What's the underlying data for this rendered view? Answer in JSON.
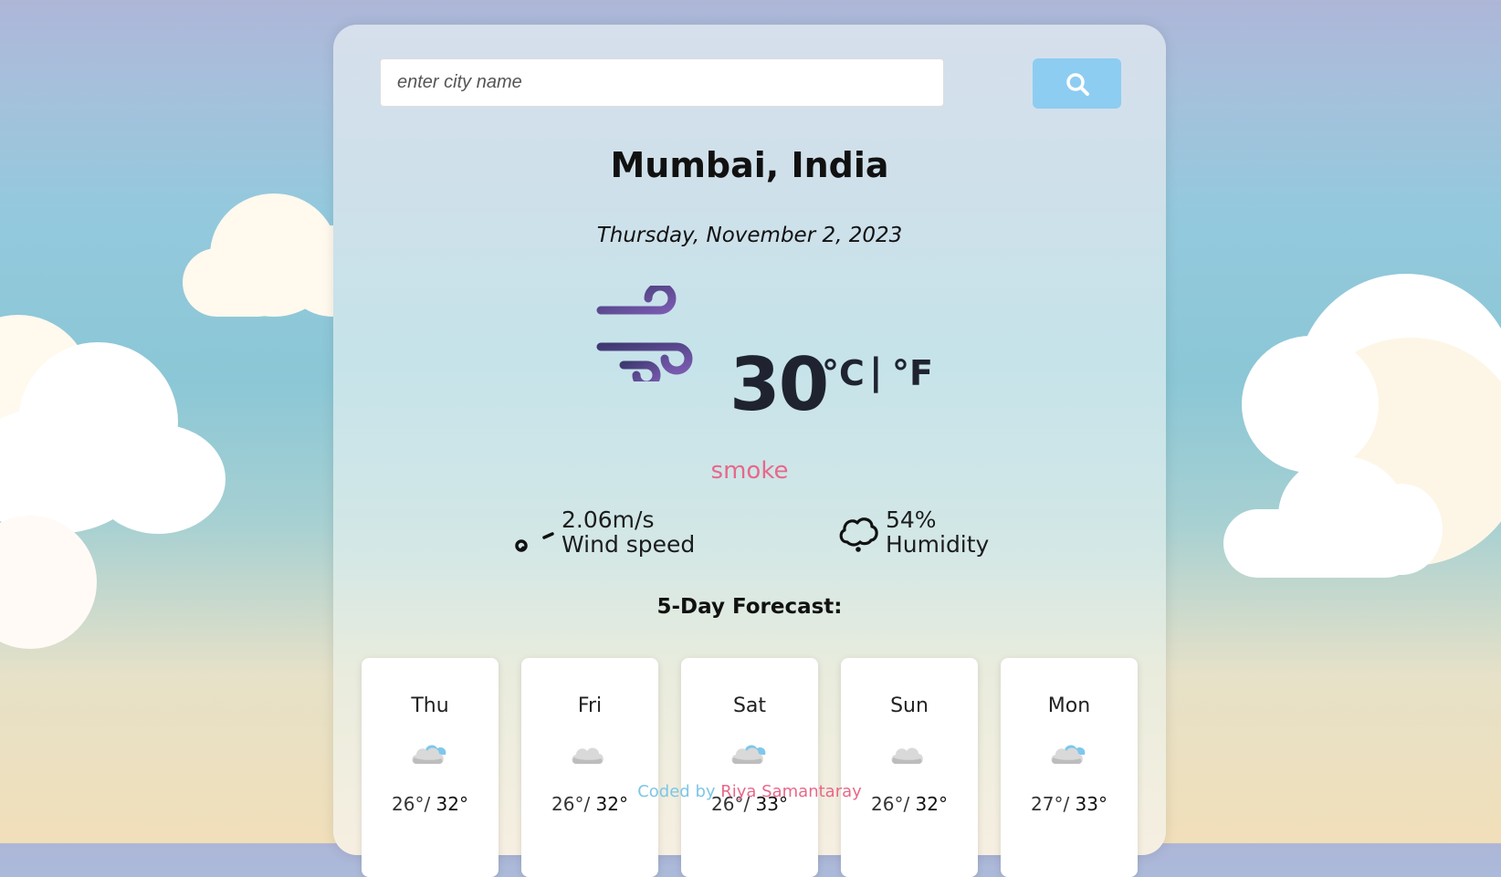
{
  "search": {
    "placeholder": "enter city name",
    "value": ""
  },
  "search_button_icon": "search-icon",
  "city": "Mumbai, India",
  "date": "Thursday, November 2, 2023",
  "current": {
    "icon": "wind-icon",
    "temperature": "30",
    "unit_c": "°C",
    "separator": "|",
    "unit_f": "°F",
    "description": "smoke"
  },
  "wind": {
    "icon": "wind-gauge-icon",
    "value": "2.06m/s",
    "label": "Wind speed"
  },
  "humidity": {
    "icon": "cloud-outline-icon",
    "value": "54%",
    "label": "Humidity"
  },
  "forecast": {
    "title": "5-Day Forecast:",
    "days": [
      {
        "day": "Thu",
        "icon": "cloud-icon",
        "min": "26°/",
        "max": "32°"
      },
      {
        "day": "Fri",
        "icon": "cloud-icon",
        "min": "26°/",
        "max": "32°"
      },
      {
        "day": "Sat",
        "icon": "cloud-icon",
        "min": "26°/",
        "max": "33°"
      },
      {
        "day": "Sun",
        "icon": "cloud-icon",
        "min": "26°/",
        "max": "32°"
      },
      {
        "day": "Mon",
        "icon": "cloud-icon",
        "min": "27°/",
        "max": "33°"
      }
    ]
  },
  "footer": {
    "prefix": "Coded by",
    "author": "Riya Samantaray"
  },
  "colors": {
    "accent": "#8dcdf1",
    "description": "#e8688a",
    "footer_prefix": "#7cc6e6"
  }
}
